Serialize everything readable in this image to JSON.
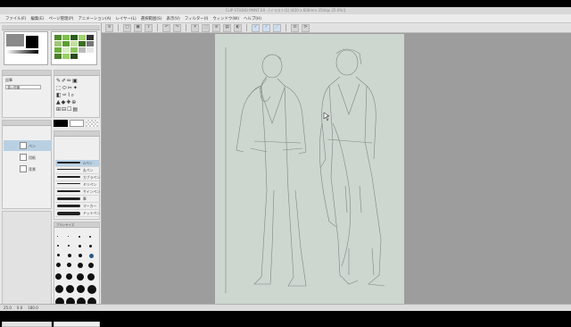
{
  "window": {
    "title": "CLIP STUDIO PAINT EX - [イラスト(1) (420 x 600mm 350dpi 25.0%)]"
  },
  "menu": [
    "ファイル(F)",
    "編集(E)",
    "ページ管理(P)",
    "アニメーション(A)",
    "レイヤー(L)",
    "選択範囲(S)",
    "表示(V)",
    "フィルター(I)",
    "ウィンドウ(W)",
    "ヘルプ(H)"
  ],
  "toolbar": {
    "icons": [
      "menu-icon",
      "new-icon",
      "save-icon",
      "undo-icon",
      "redo-icon",
      "clear-icon",
      "transform-icon",
      "deselect-icon",
      "fill-icon",
      "invert-icon",
      "snap-icon",
      "ruler-icon",
      "grid-icon",
      "display-icon"
    ]
  },
  "left_panel": {
    "sub_tool_label": "鉛筆",
    "brush_size": "濃い鉛筆",
    "layer_names": [
      "ペン",
      "用紙",
      "背景"
    ],
    "brush_labels": [
      "Gペン",
      "丸ペン",
      "カブラペン",
      "ミリペン",
      "サインペン",
      "筆",
      "マーカー",
      "ドットペン"
    ],
    "material_header": "ブラシサイズ"
  },
  "colors": {
    "canvas_bg": "#cdd6cf",
    "workspace": "#9d9d9d",
    "accent_green": "#7fbf4a",
    "selection_blue": "#b9d0e3"
  },
  "status": {
    "zoom": "25.0",
    "rotation": "0.0",
    "coords": "180.0"
  }
}
